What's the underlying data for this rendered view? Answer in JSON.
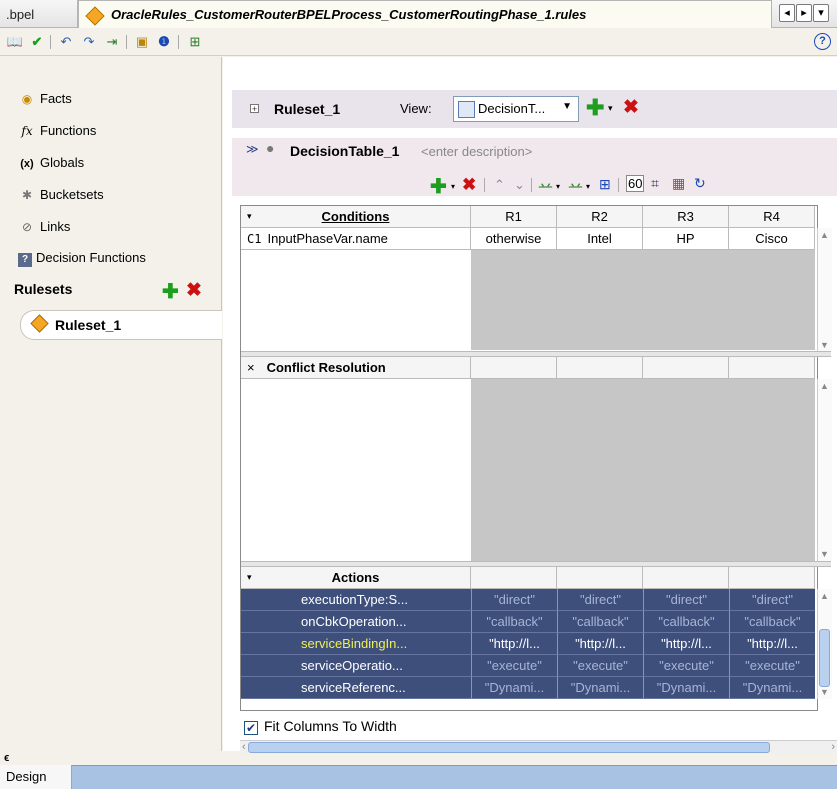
{
  "tabs": {
    "bpel": ".bpel",
    "rules": "OracleRules_CustomerRouterBPELProcess_CustomerRoutingPhase_1.rules"
  },
  "left_nav": {
    "items": [
      {
        "label": "Facts",
        "icon": "facts-icon"
      },
      {
        "label": "Functions",
        "icon": "fx-icon"
      },
      {
        "label": "Globals",
        "icon": "globals-icon"
      },
      {
        "label": "Bucketsets",
        "icon": "bucketsets-icon"
      },
      {
        "label": "Links",
        "icon": "links-icon"
      },
      {
        "label": "Decision Functions",
        "icon": "decision-functions-icon"
      }
    ],
    "rulesets_title": "Rulesets",
    "ruleset_item": "Ruleset_1"
  },
  "ruleset_header": {
    "name": "Ruleset_1",
    "view_label": "View:",
    "view_value": "DecisionT..."
  },
  "decision_table": {
    "name": "DecisionTable_1",
    "description_placeholder": "<enter description>"
  },
  "conditions": {
    "title": "Conditions",
    "rule_columns": [
      "R1",
      "R2",
      "R3",
      "R4"
    ],
    "rows": [
      {
        "id": "C1",
        "expr": "InputPhaseVar.name",
        "values": [
          "otherwise",
          "Intel",
          "HP",
          "Cisco"
        ]
      }
    ]
  },
  "conflict": {
    "title": "Conflict Resolution"
  },
  "actions": {
    "title": "Actions",
    "rows": [
      {
        "label": "executionType:S...",
        "values": [
          "\"direct\"",
          "\"direct\"",
          "\"direct\"",
          "\"direct\""
        ]
      },
      {
        "label": "onCbkOperation...",
        "values": [
          "\"callback\"",
          "\"callback\"",
          "\"callback\"",
          "\"callback\""
        ]
      },
      {
        "label": "serviceBindingIn...",
        "values": [
          "\"http://l...",
          "\"http://l...",
          "\"http://l...",
          "\"http://l..."
        ],
        "highlighted": true
      },
      {
        "label": "serviceOperatio...",
        "values": [
          "\"execute\"",
          "\"execute\"",
          "\"execute\"",
          "\"execute\""
        ]
      },
      {
        "label": "serviceReferenc...",
        "values": [
          "\"Dynami...",
          "\"Dynami...",
          "\"Dynami...",
          "\"Dynami..."
        ]
      }
    ]
  },
  "fit_columns": {
    "label": "Fit Columns To Width",
    "checked": true
  },
  "status": {
    "design_tab": "Design"
  },
  "colors": {
    "action_bg": "#3e4f7b",
    "highlight_text": "#f0f050",
    "add_green": "#1e9e1e",
    "delete_red": "#cc1111"
  }
}
